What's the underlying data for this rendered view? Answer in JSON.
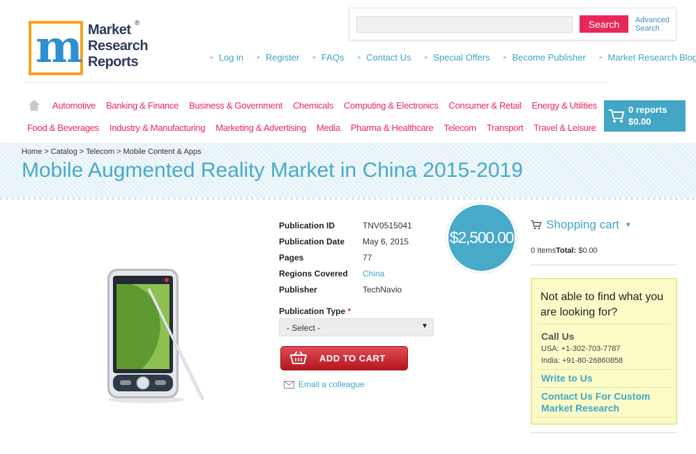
{
  "logo": {
    "line1": "Market",
    "line2": "Research",
    "line3": "Reports",
    "registered": "®"
  },
  "search": {
    "placeholder": "",
    "button_label": "Search",
    "advanced_line1": "Advanced",
    "advanced_line2": "Search"
  },
  "top_links": [
    "Log in",
    "Register",
    "FAQs",
    "Contact Us",
    "Special Offers",
    "Become Publisher",
    "Market Research Blog"
  ],
  "categories_row1": [
    "Automotive",
    "Banking & Finance",
    "Business & Government",
    "Chemicals",
    "Computing & Electronics",
    "Consumer & Retail",
    "Energy & Utilities"
  ],
  "categories_row2": [
    "Food & Beverages",
    "Industry & Manufacturing",
    "Marketing & Advertising",
    "Media",
    "Pharma & Healthcare",
    "Telecom",
    "Transport",
    "Travel & Leisure"
  ],
  "header_cart": {
    "reports": "0 reports",
    "amount": "$0.00"
  },
  "breadcrumb": [
    "Home",
    "Catalog",
    "Telecom",
    "Mobile Content & Apps"
  ],
  "breadcrumb_sep": ">",
  "page_title": "Mobile Augmented Reality Market in China 2015-2019",
  "details": [
    {
      "label": "Publication ID",
      "value": "TNV0515041"
    },
    {
      "label": "Publication Date",
      "value": "May 6, 2015"
    },
    {
      "label": "Pages",
      "value": "77"
    },
    {
      "label": "Regions Covered",
      "value": "China"
    },
    {
      "label": "Publisher",
      "value": "TechNavio"
    }
  ],
  "price": "$2,500.00",
  "publication_type": {
    "label": "Publication Type",
    "required_mark": "*",
    "selected": "- Select -"
  },
  "add_to_cart_label": "ADD TO CART",
  "email_colleague_label": "Email a colleague",
  "shopping_cart": {
    "title": "Shopping cart",
    "items": "0 Items",
    "total_label": "Total:",
    "total_value": "$0.00"
  },
  "help_box": {
    "question": "Not able to find what you are looking for?",
    "call_us": "Call Us",
    "usa_phone": "USA: +1-302-703-7787",
    "india_phone": "India: +91-80-26860858",
    "write_to_us": "Write to Us",
    "contact_custom": "Contact Us For Custom Market Research"
  },
  "colors": {
    "accent_blue": "#47aac8",
    "link_blue": "#3fa5c4",
    "category_pink": "#e8285a",
    "add_to_cart_red": "#c9202b",
    "help_box_bg": "#fbfbc8"
  }
}
